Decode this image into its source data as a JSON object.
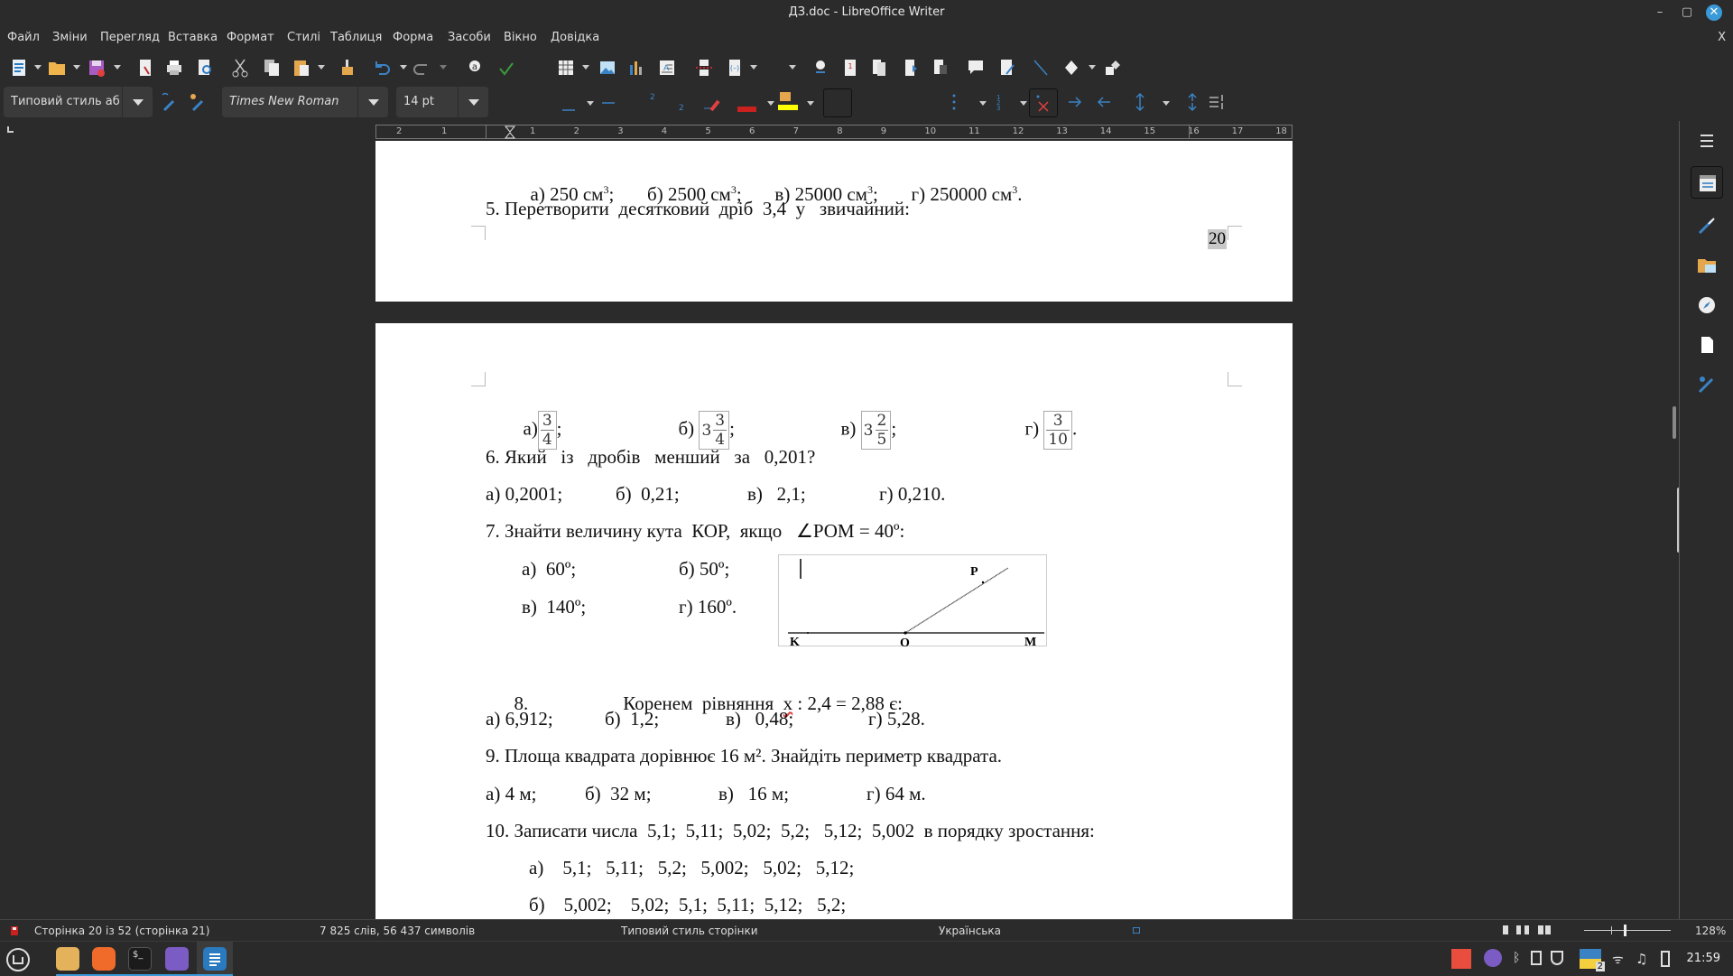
{
  "window": {
    "title": "ДЗ.doc - LibreOffice Writer",
    "minimize": "–",
    "maximize": "▢",
    "close": "✕",
    "doc_close": "X"
  },
  "menu": [
    "Файл",
    "Зміни",
    "Перегляд",
    "Вставка",
    "Формат",
    "Стилі",
    "Таблиця",
    "Форма",
    "Засоби",
    "Вікно",
    "Довідка"
  ],
  "format_bar": {
    "paragraph_style": "Типовий стиль абз",
    "font_name": "Times New Roman",
    "font_size": "14 pt"
  },
  "ruler": {
    "left_numbers": [
      "2",
      "1"
    ],
    "numbers": [
      "1",
      "2",
      "3",
      "4",
      "5",
      "6",
      "7",
      "8",
      "9",
      "10",
      "11",
      "12",
      "13",
      "14",
      "15",
      "16",
      "17",
      "18"
    ]
  },
  "page1": {
    "line_q4_options": {
      "a": "а) 250 см",
      "b": "б) 2500 см",
      "v": "в) 25000 см",
      "g": "г) 250000 см",
      "sup": "3",
      "sep": ";",
      "end": "."
    },
    "q5": "5. Перетворити  десятковий  дріб  3,4  у   звичайний:",
    "page_number": "20"
  },
  "page2": {
    "q5_options": [
      {
        "label": "а)",
        "whole": "",
        "num": "3",
        "den": "4",
        "end": ";"
      },
      {
        "label": "б)",
        "whole": "3",
        "num": "3",
        "den": "4",
        "end": ";"
      },
      {
        "label": "в)",
        "whole": "3",
        "num": "2",
        "den": "5",
        "end": ";"
      },
      {
        "label": "г)",
        "whole": "",
        "num": "3",
        "den": "10",
        "end": "."
      }
    ],
    "q6": "6. Який   із   дробів   менший   за   0,201?",
    "q6_options": [
      "а) 0,2001;",
      "б)  0,21;",
      "в)   2,1;",
      "г) 0,210."
    ],
    "q7": "7. Знайти величину кута  КОР,  якщо   ∠РОМ = 40º:",
    "q7_options": [
      "а)  60º;",
      "б) 50º;",
      "в)  140º;",
      "г) 160º."
    ],
    "diagram_labels": {
      "P": "P",
      "K": "K",
      "O": "O",
      "M": "M"
    },
    "q8_num": "8.",
    "q8_text_a": "Коренем  рівняння  ",
    "q8_x": "x",
    "q8_text_b": " : 2,4 = 2,88 є:",
    "q8_options": [
      "а) 6,912;",
      "б)  1,2;",
      "в)   0,48;",
      "г) 5,28."
    ],
    "q9": "9. Площа квадрата дорівнює 16 м². Знайдіть периметр квадрата.",
    "q9_options": [
      "а) 4 м;",
      "б)  32 м;",
      "в)   16 м;",
      "г) 64 м."
    ],
    "q10": "10. Записати числа  5,1;  5,11;  5,02;  5,2;   5,12;  5,002  в порядку зростання:",
    "q10_a": "а)    5,1;   5,11;   5,2;   5,002;   5,02;   5,12;",
    "q10_b": "б)    5,002;    5,02;  5,1;  5,11;  5,12;   5,2;"
  },
  "statusbar": {
    "page": "Сторінка 20 із 52 (сторінка 21)",
    "words": "7 825 слів, 56 437 символів",
    "page_style": "Типовий стиль сторінки",
    "language": "Українська",
    "zoom": "128%"
  },
  "taskbar": {
    "clock": "21:59",
    "workspace_badge": "2"
  }
}
